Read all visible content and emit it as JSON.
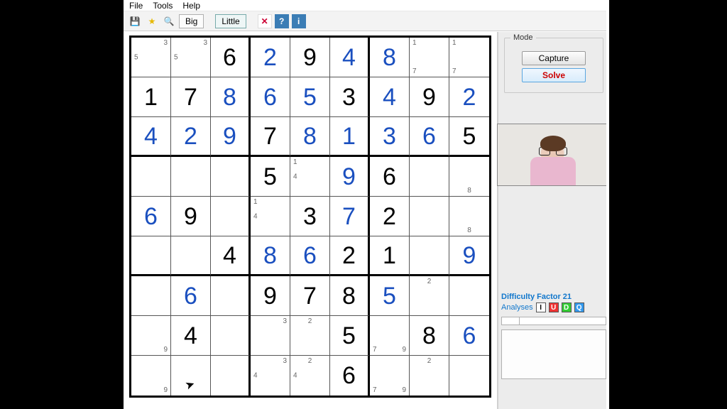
{
  "menu": {
    "file": "File",
    "tools": "Tools",
    "help": "Help"
  },
  "toolbar": {
    "big": "Big",
    "little": "Little",
    "help_char": "?",
    "info_char": "i",
    "del_char": "✕"
  },
  "mode": {
    "legend": "Mode",
    "capture": "Capture",
    "solve": "Solve"
  },
  "analysis": {
    "difficulty": "Difficulty Factor 21",
    "label": "Analyses",
    "a1": "I",
    "a2": "U",
    "a3": "D",
    "a4": "Q"
  },
  "grid": [
    [
      {
        "c": [
          {
            "p": 3,
            "v": "3"
          },
          {
            "p": 4,
            "v": "5"
          }
        ]
      },
      {
        "c": [
          {
            "p": 3,
            "v": "3"
          },
          {
            "p": 4,
            "v": "5"
          }
        ]
      },
      {
        "v": "6",
        "t": "g"
      },
      {
        "v": "2",
        "t": "s"
      },
      {
        "v": "9",
        "t": "g"
      },
      {
        "v": "4",
        "t": "s"
      },
      {
        "v": "8",
        "t": "s"
      },
      {
        "c": [
          {
            "p": 1,
            "v": "1"
          },
          {
            "p": 7,
            "v": "7"
          }
        ]
      },
      {
        "c": [
          {
            "p": 1,
            "v": "1"
          },
          {
            "p": 7,
            "v": "7"
          }
        ]
      }
    ],
    [
      {
        "v": "1",
        "t": "g"
      },
      {
        "v": "7",
        "t": "g"
      },
      {
        "v": "8",
        "t": "s"
      },
      {
        "v": "6",
        "t": "s"
      },
      {
        "v": "5",
        "t": "s"
      },
      {
        "v": "3",
        "t": "g"
      },
      {
        "v": "4",
        "t": "s"
      },
      {
        "v": "9",
        "t": "g"
      },
      {
        "v": "2",
        "t": "s"
      }
    ],
    [
      {
        "v": "4",
        "t": "s"
      },
      {
        "v": "2",
        "t": "s"
      },
      {
        "v": "9",
        "t": "s"
      },
      {
        "v": "7",
        "t": "g"
      },
      {
        "v": "8",
        "t": "s"
      },
      {
        "v": "1",
        "t": "s"
      },
      {
        "v": "3",
        "t": "s"
      },
      {
        "v": "6",
        "t": "s"
      },
      {
        "v": "5",
        "t": "g"
      }
    ],
    [
      {},
      {},
      {},
      {
        "v": "5",
        "t": "g"
      },
      {
        "c": [
          {
            "p": 1,
            "v": "1"
          },
          {
            "p": 4,
            "v": "4"
          }
        ]
      },
      {
        "v": "9",
        "t": "s"
      },
      {
        "v": "6",
        "t": "g"
      },
      {},
      {
        "c": [
          {
            "p": 8,
            "v": "8"
          }
        ]
      }
    ],
    [
      {
        "v": "6",
        "t": "s"
      },
      {
        "v": "9",
        "t": "g"
      },
      {},
      {
        "c": [
          {
            "p": 1,
            "v": "1"
          },
          {
            "p": 4,
            "v": "4"
          }
        ]
      },
      {
        "v": "3",
        "t": "g"
      },
      {
        "v": "7",
        "t": "s"
      },
      {
        "v": "2",
        "t": "g"
      },
      {},
      {
        "c": [
          {
            "p": 8,
            "v": "8"
          }
        ]
      }
    ],
    [
      {},
      {},
      {
        "v": "4",
        "t": "g"
      },
      {
        "v": "8",
        "t": "s"
      },
      {
        "v": "6",
        "t": "s"
      },
      {
        "v": "2",
        "t": "g"
      },
      {
        "v": "1",
        "t": "g"
      },
      {},
      {
        "v": "9",
        "t": "s"
      }
    ],
    [
      {},
      {
        "v": "6",
        "t": "s"
      },
      {},
      {
        "v": "9",
        "t": "g"
      },
      {
        "v": "7",
        "t": "g"
      },
      {
        "v": "8",
        "t": "g"
      },
      {
        "v": "5",
        "t": "s"
      },
      {
        "c": [
          {
            "p": 2,
            "v": "2"
          }
        ]
      },
      {}
    ],
    [
      {
        "c": [
          {
            "p": 9,
            "v": "9"
          }
        ]
      },
      {
        "v": "4",
        "t": "g"
      },
      {},
      {
        "c": [
          {
            "p": 3,
            "v": "3"
          }
        ]
      },
      {
        "c": [
          {
            "p": 2,
            "v": "2"
          }
        ]
      },
      {
        "v": "5",
        "t": "g"
      },
      {
        "c": [
          {
            "p": 7,
            "v": "7"
          },
          {
            "p": 9,
            "v": "9"
          }
        ]
      },
      {
        "v": "8",
        "t": "g"
      },
      {
        "v": "6",
        "t": "s"
      }
    ],
    [
      {
        "c": [
          {
            "p": 9,
            "v": "9"
          }
        ]
      },
      {},
      {},
      {
        "c": [
          {
            "p": 3,
            "v": "3"
          },
          {
            "p": 4,
            "v": "4"
          }
        ]
      },
      {
        "c": [
          {
            "p": 2,
            "v": "2"
          },
          {
            "p": 4,
            "v": "4"
          }
        ]
      },
      {
        "v": "6",
        "t": "g"
      },
      {
        "c": [
          {
            "p": 7,
            "v": "7"
          },
          {
            "p": 9,
            "v": "9"
          }
        ]
      },
      {
        "c": [
          {
            "p": 2,
            "v": "2"
          }
        ]
      },
      {}
    ]
  ]
}
